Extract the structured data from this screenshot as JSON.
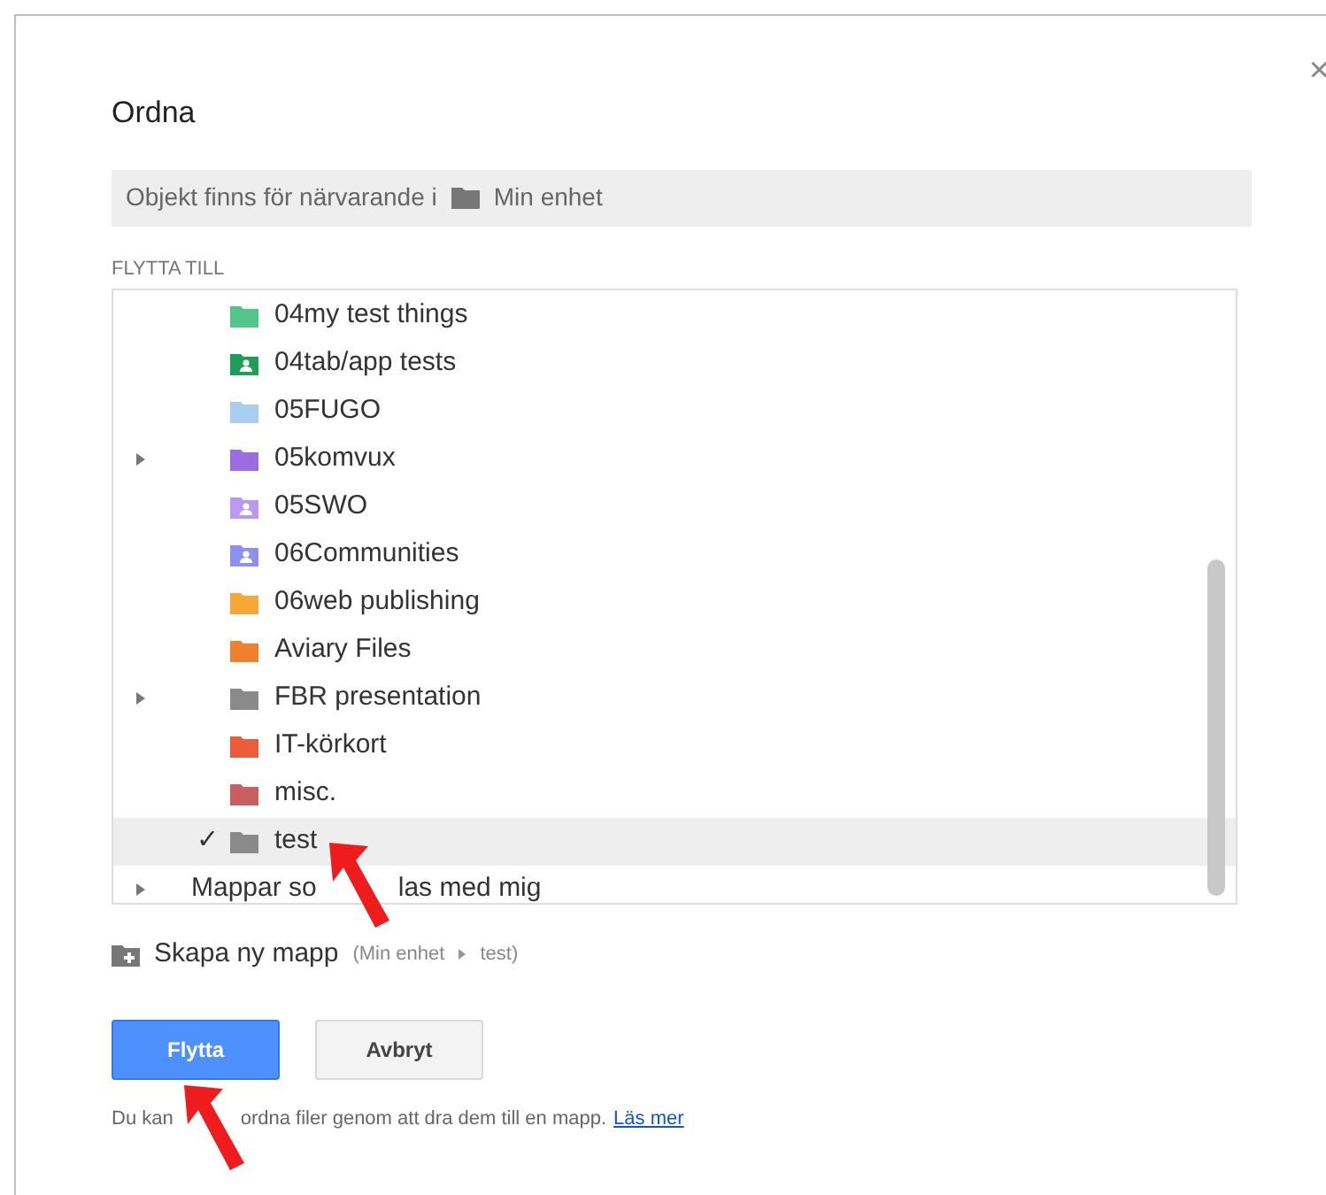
{
  "dialog": {
    "title": "Ordna",
    "close": "×"
  },
  "location": {
    "text": "Objekt finns för närvarande i",
    "folder": "Min enhet"
  },
  "section_label": "FLYTTA TILL",
  "check_mark": "✓",
  "folders": [
    {
      "name": "04my test things",
      "kind": "folder",
      "color": "#52c68a",
      "expandable": false,
      "selected": false
    },
    {
      "name": "04tab/app tests",
      "kind": "shared",
      "color": "#1e9e58",
      "expandable": false,
      "selected": false
    },
    {
      "name": "05FUGO",
      "kind": "folder",
      "color": "#a9cdf0",
      "expandable": false,
      "selected": false
    },
    {
      "name": "05komvux",
      "kind": "folder",
      "color": "#9b6de0",
      "expandable": true,
      "selected": false
    },
    {
      "name": "05SWO",
      "kind": "shared",
      "color": "#b89af0",
      "expandable": false,
      "selected": false
    },
    {
      "name": "06Communities",
      "kind": "shared",
      "color": "#8f8ff0",
      "expandable": false,
      "selected": false
    },
    {
      "name": "06web publishing",
      "kind": "folder",
      "color": "#f7a738",
      "expandable": false,
      "selected": false
    },
    {
      "name": "Aviary Files",
      "kind": "folder",
      "color": "#f0812c",
      "expandable": false,
      "selected": false
    },
    {
      "name": "FBR presentation",
      "kind": "folder",
      "color": "#8a8a8a",
      "expandable": true,
      "selected": false
    },
    {
      "name": "IT-körkort",
      "kind": "folder",
      "color": "#ec5b3a",
      "expandable": false,
      "selected": false
    },
    {
      "name": "misc.",
      "kind": "folder",
      "color": "#c86060",
      "expandable": false,
      "selected": false
    },
    {
      "name": "test",
      "kind": "folder",
      "color": "#8a8a8a",
      "expandable": false,
      "selected": true
    }
  ],
  "shared_row": {
    "parts": [
      "Mappar so",
      "las med mig"
    ],
    "expandable": true
  },
  "new_folder": {
    "label": "Skapa ny mapp",
    "path_start": "(Min enhet",
    "path_end": "test)"
  },
  "buttons": [
    {
      "label": "Flytta",
      "kind": "primary"
    },
    {
      "label": "Avbryt",
      "kind": "secondary"
    }
  ],
  "help": {
    "parts": [
      "Du kan",
      "ordna filer genom att dra dem till en mapp."
    ],
    "link": "Läs mer"
  }
}
